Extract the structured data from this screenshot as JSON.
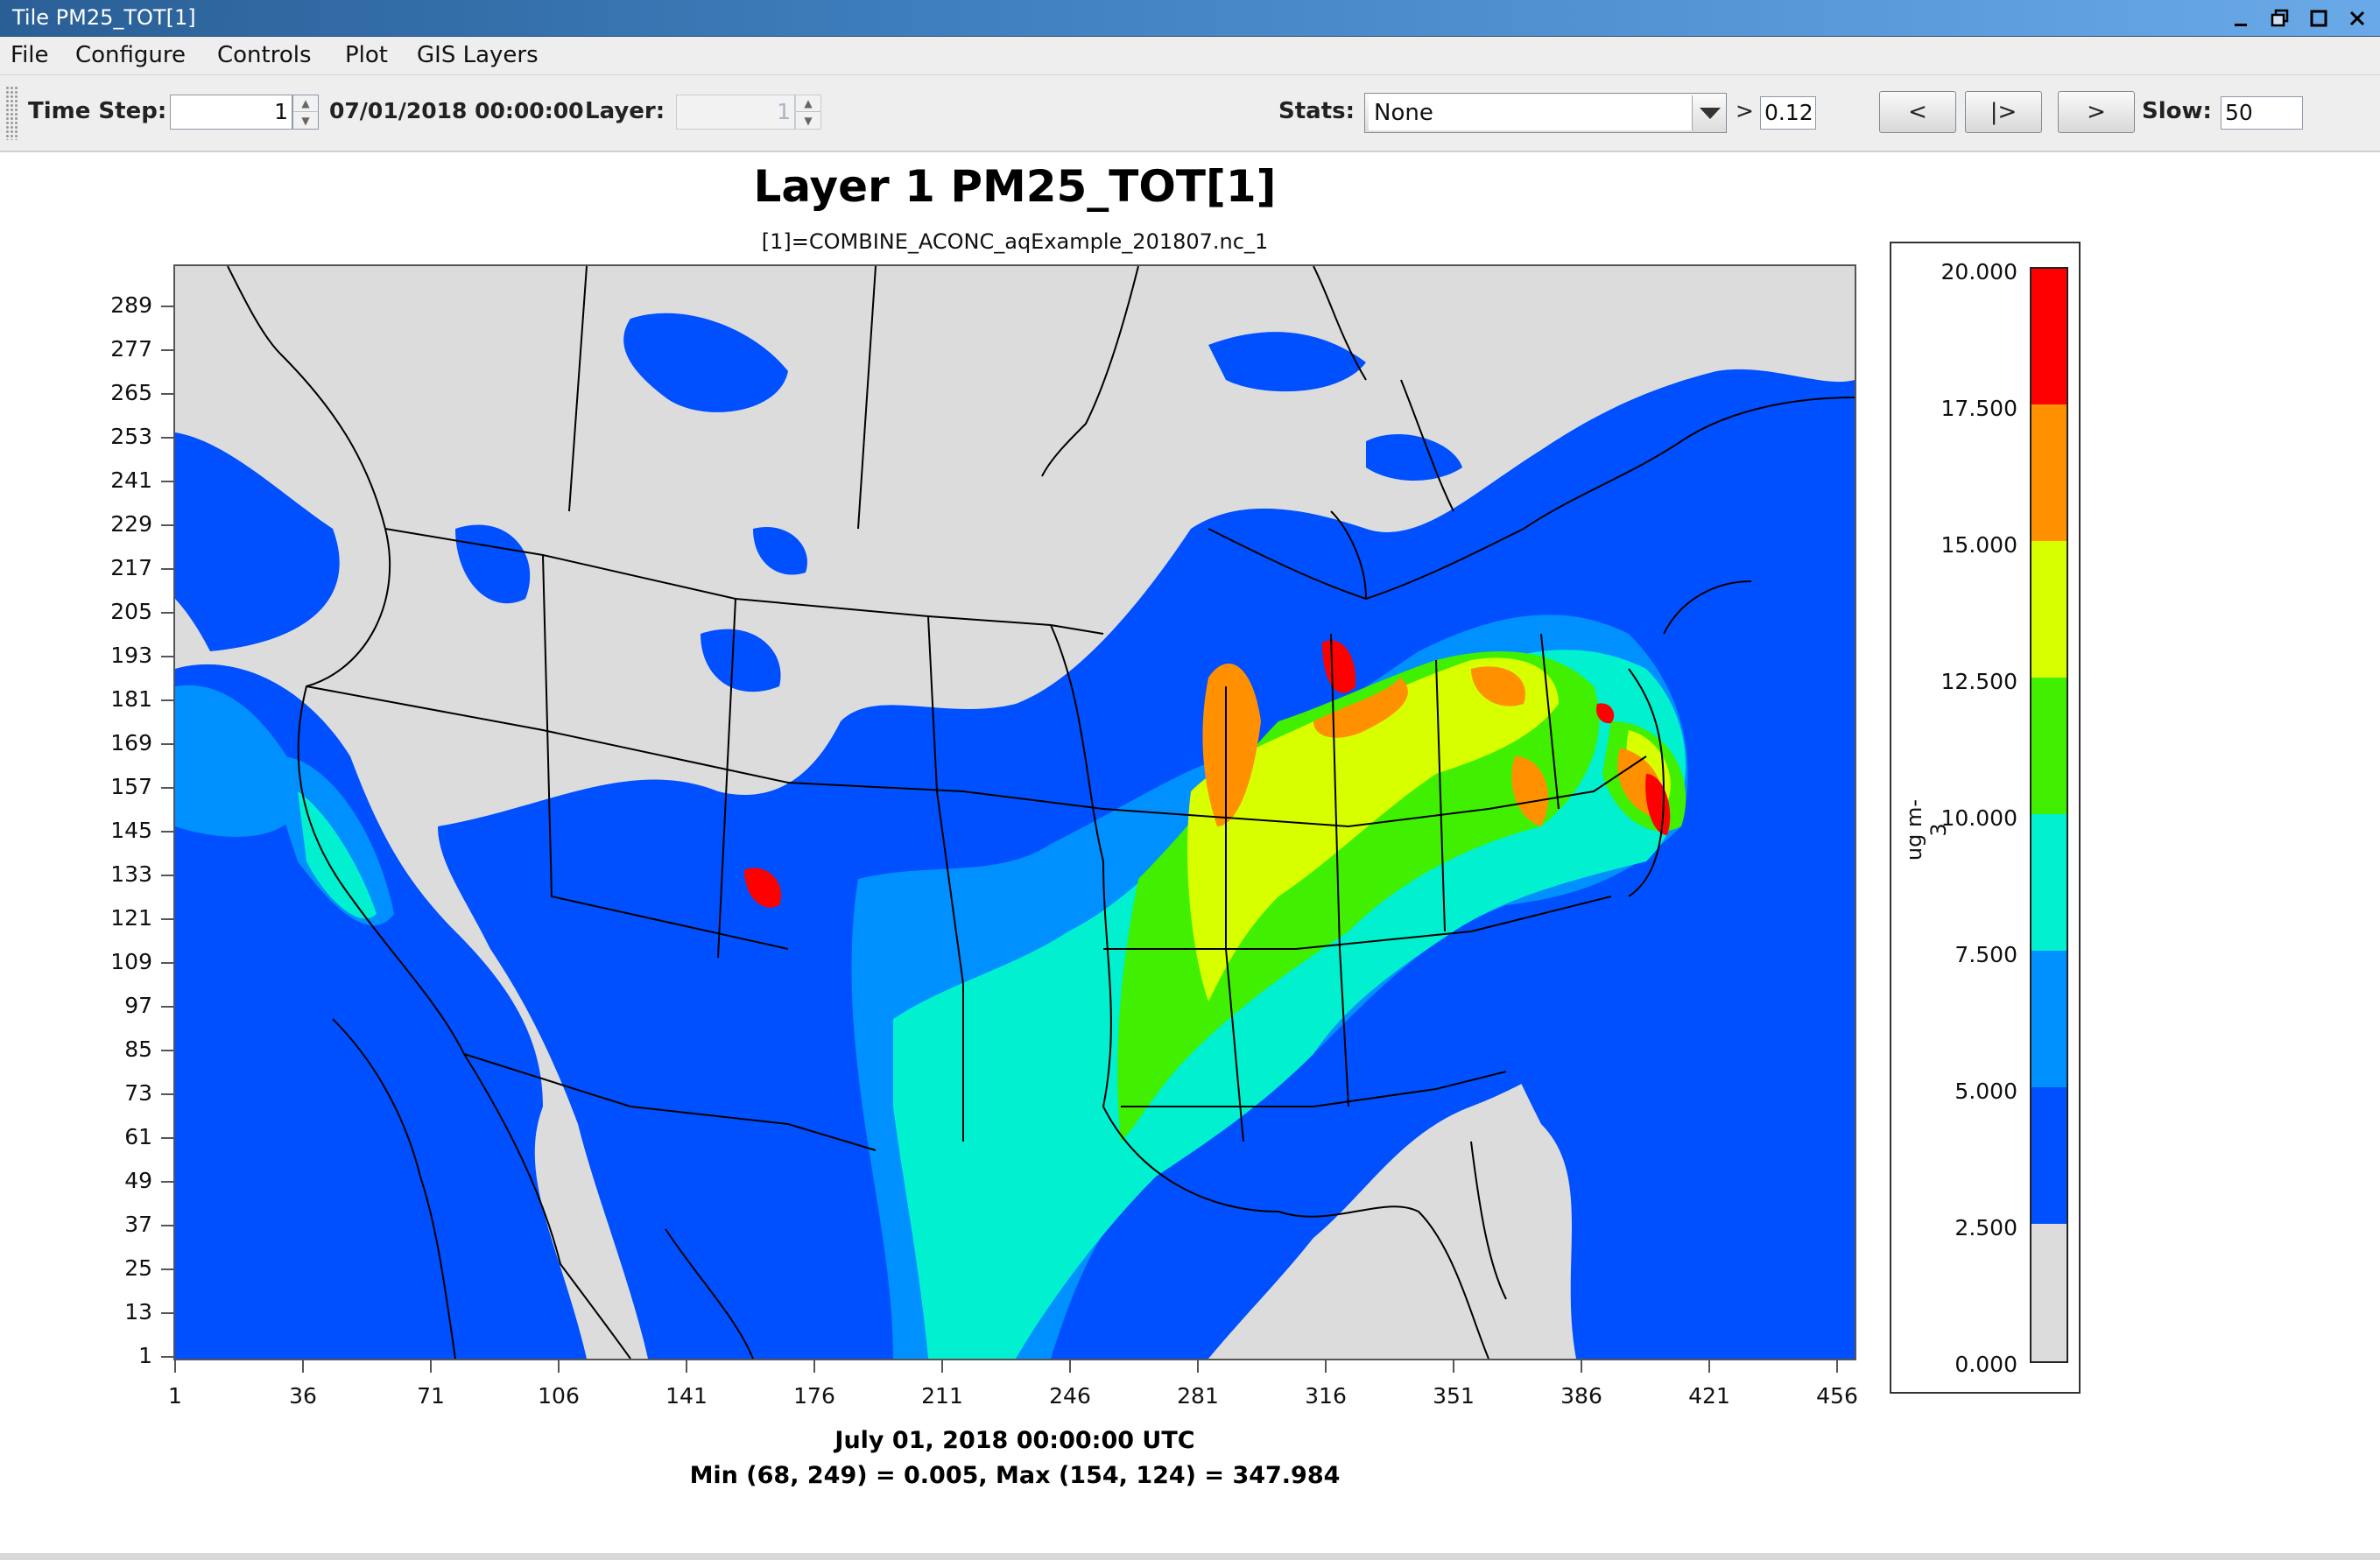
{
  "window": {
    "title": "Tile PM25_TOT[1]",
    "controls": [
      "minimize-icon",
      "restore-icon",
      "maximize-icon",
      "close-icon"
    ]
  },
  "menu": {
    "file": "File",
    "configure": "Configure",
    "controls": "Controls",
    "plot": "Plot",
    "gis_layers": "GIS Layers"
  },
  "toolbar": {
    "time_step_label": "Time Step:",
    "time_step_value": "1",
    "datetime": "07/01/2018 00:00:00",
    "layer_label": "Layer:",
    "layer_value": "1",
    "stats_label": "Stats:",
    "stats_value": "None",
    "threshold_label": ">",
    "threshold_value": "0.12",
    "prev_button": "<",
    "play_button": "|>",
    "next_button": ">",
    "slow_label": "Slow:",
    "slow_value": "50"
  },
  "plot": {
    "title": "Layer 1 PM25_TOT[1]",
    "subtitle": "[1]=COMBINE_ACONC_aqExample_201807.nc_1",
    "date_footer": "July 01, 2018 00:00:00 UTC",
    "stats_footer": "Min (68, 249) = 0.005, Max (154, 124) = 347.984"
  },
  "chart_data": {
    "type": "heatmap",
    "title": "Layer 1 PM25_TOT[1]",
    "subtitle": "[1]=COMBINE_ACONC_aqExample_201807.nc_1",
    "variable": "PM25_TOT",
    "units": "ug m-3",
    "x_ticks": [
      "1",
      "36",
      "71",
      "106",
      "141",
      "176",
      "211",
      "246",
      "281",
      "316",
      "351",
      "386",
      "421",
      "456"
    ],
    "y_ticks": [
      "289",
      "277",
      "265",
      "253",
      "241",
      "229",
      "217",
      "205",
      "193",
      "181",
      "169",
      "157",
      "145",
      "133",
      "121",
      "109",
      "97",
      "85",
      "73",
      "61",
      "49",
      "37",
      "25",
      "13",
      "1"
    ],
    "xlim": [
      1,
      459
    ],
    "ylim": [
      1,
      299
    ],
    "legend": {
      "labels": [
        "20.000",
        "17.500",
        "15.000",
        "12.500",
        "10.000",
        "7.500",
        "5.000",
        "2.500",
        "0.000"
      ],
      "bins": [
        {
          "min": 17.5,
          "max": 20.0,
          "color": "#ff0000"
        },
        {
          "min": 15.0,
          "max": 17.5,
          "color": "#ff9000"
        },
        {
          "min": 12.5,
          "max": 15.0,
          "color": "#d8ff00"
        },
        {
          "min": 10.0,
          "max": 12.5,
          "color": "#40f000"
        },
        {
          "min": 7.5,
          "max": 10.0,
          "color": "#00f0d0"
        },
        {
          "min": 5.0,
          "max": 7.5,
          "color": "#0090ff"
        },
        {
          "min": 2.5,
          "max": 5.0,
          "color": "#0050ff"
        },
        {
          "min": 0.0,
          "max": 2.5,
          "color": "#dcdcdc"
        }
      ],
      "placement": "right"
    },
    "min": {
      "col": 68,
      "row": 249,
      "value": 0.005
    },
    "max": {
      "col": 154,
      "row": 124,
      "value": 347.984
    },
    "time": "July 01, 2018 00:00:00 UTC"
  },
  "colors": {
    "background_grey": "#dcdcdc",
    "low_blue": "#0050ff",
    "mid_blue": "#0090ff",
    "cyan": "#00f0d0",
    "green": "#40f000",
    "yellow": "#d8ff00",
    "orange": "#ff9000",
    "red": "#ff0000"
  }
}
